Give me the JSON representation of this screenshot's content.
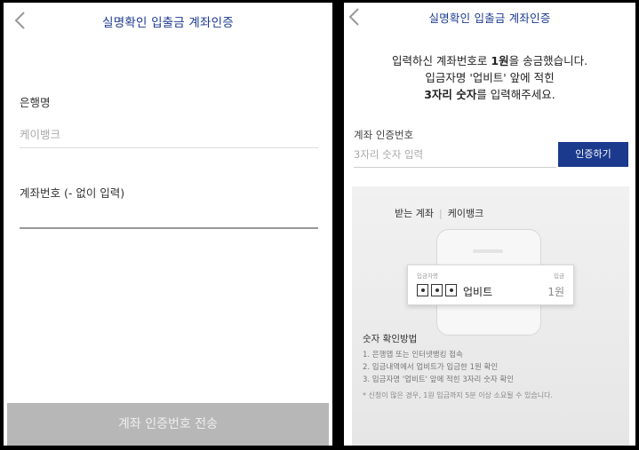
{
  "left": {
    "title": "실명확인 입출금 계좌인증",
    "bank_label": "은행명",
    "bank_value": "케이뱅크",
    "account_label": "계좌번호 (- 없이 입력)",
    "account_value": "",
    "submit_label": "계좌 인증번호 전송"
  },
  "right": {
    "title": "실명확인 입출금 계좌인증",
    "message": {
      "line1_pre": "입력하신 계좌번호로 ",
      "line1_bold": "1원",
      "line1_post": "을 송금했습니다.",
      "line2": "입금자명 '업비트' 앞에 적힌",
      "line3_bold": "3자리 숫자",
      "line3_post": "를 입력해주세요."
    },
    "code_label": "계좌 인증번호",
    "code_placeholder": "3자리 숫자 입력",
    "verify_label": "인증하기",
    "guide": {
      "tab_receive": "받는 계좌",
      "tab_bank": "케이뱅크",
      "card_left_small": "입금자명",
      "card_right_small": "입금",
      "card_name": "업비트",
      "card_amount": "1원",
      "howto_title": "숫자 확인방법",
      "steps": [
        "1. 은행앱 또는 인터넷뱅킹 접속",
        "2. 입금내역에서 업비트가 입금한 1원 확인",
        "3. 입금자명 '업비트' 앞에 적힌 3자리 숫자 확인"
      ],
      "note": "* 신청이 많은 경우, 1원 입금까지 5분 이상 소요될 수 있습니다."
    }
  },
  "icons": {
    "back": "chevron-left-icon",
    "digit": "dot-box-icon"
  },
  "colors": {
    "accent": "#1b3a8e",
    "disabled_button": "#b7b7b7"
  }
}
